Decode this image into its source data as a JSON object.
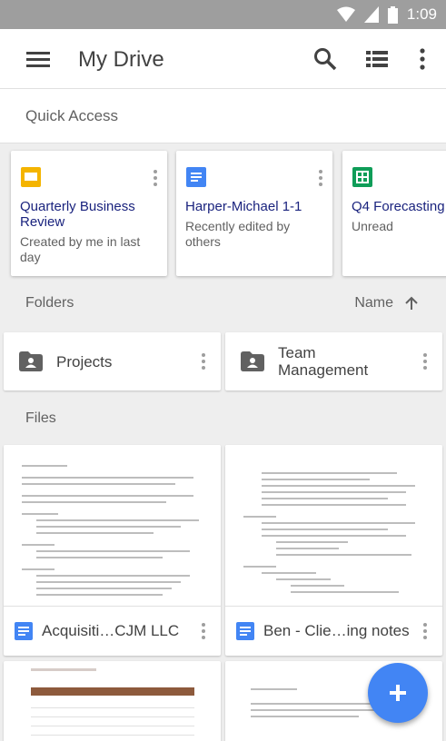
{
  "status_bar": {
    "time": "1:09"
  },
  "app_bar": {
    "title": "My Drive",
    "icons": [
      "menu-icon",
      "search-icon",
      "list-view-icon",
      "more-vert-icon"
    ]
  },
  "quick_access": {
    "label": "Quick Access",
    "cards": [
      {
        "name": "Quarterly Business Review",
        "subtitle": "Created by me in last day",
        "type": "slides",
        "color": "#f4b400"
      },
      {
        "name": "Harper-Michael 1-1",
        "subtitle": "Recently edited by others",
        "type": "docs",
        "color": "#4285f4"
      },
      {
        "name": "Q4 Forecasting",
        "subtitle": "Unread",
        "type": "sheets",
        "color": "#0f9d58"
      }
    ]
  },
  "folders": {
    "label": "Folders",
    "sort_label": "Name",
    "items": [
      {
        "name": "Projects"
      },
      {
        "name": "Team Management"
      }
    ]
  },
  "files": {
    "label": "Files",
    "items": [
      {
        "name": "Acquisiti…CJM LLC",
        "type": "docs"
      },
      {
        "name": "Ben - Clie…ing notes",
        "type": "docs"
      }
    ]
  },
  "fab": {
    "icon": "plus-icon",
    "color": "#4285f4"
  }
}
